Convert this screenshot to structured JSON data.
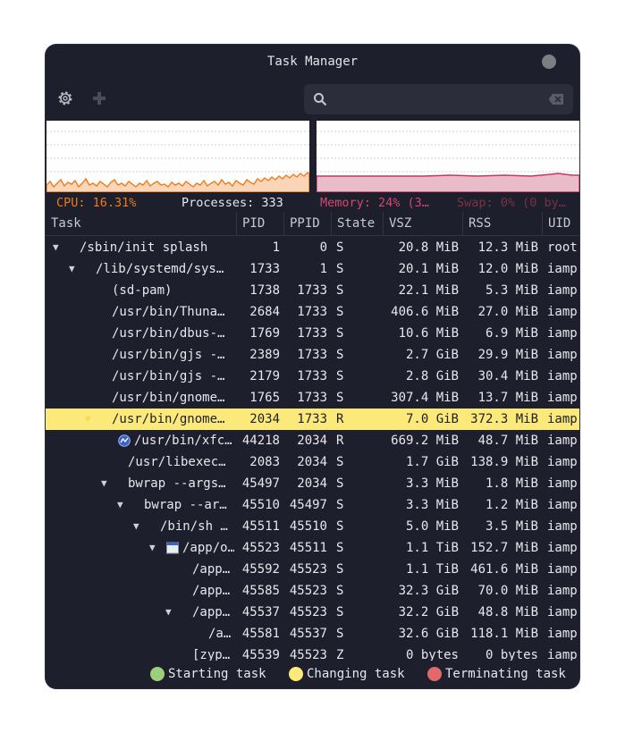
{
  "window": {
    "title": "Task Manager"
  },
  "toolbar": {
    "settings_icon": "gear-icon",
    "add_icon": "plus-icon",
    "search_placeholder": "",
    "search_icon": "search-icon",
    "clear_icon": "clear-icon"
  },
  "stats": {
    "cpu": "CPU: 16.31%",
    "processes": "Processes: 333",
    "memory": "Memory: 24% (3…",
    "swap": "Swap: 0% (0 by…"
  },
  "colors": {
    "cpu": "#f07a16",
    "memory": "#c23a64",
    "swap": "#7a3246",
    "highlight": "#fbe97a",
    "starting": "#9ccf7a",
    "changing": "#fbe97a",
    "terminating": "#e06a6a"
  },
  "columns": [
    "Task",
    "PID",
    "PPID",
    "State",
    "VSZ",
    "RSS",
    "UID"
  ],
  "rows": [
    {
      "task": "/sbin/init splash",
      "pid": "1",
      "ppid": "0",
      "state": "S",
      "vsz": "20.8 MiB",
      "rss": "12.3 MiB",
      "uid": "root"
    },
    {
      "task": "/lib/systemd/sys…",
      "pid": "1733",
      "ppid": "1",
      "state": "S",
      "vsz": "20.1 MiB",
      "rss": "12.0 MiB",
      "uid": "iampr"
    },
    {
      "task": "(sd-pam)",
      "pid": "1738",
      "ppid": "1733",
      "state": "S",
      "vsz": "22.1 MiB",
      "rss": "5.3 MiB",
      "uid": "iampr"
    },
    {
      "task": "/usr/bin/Thuna…",
      "pid": "2684",
      "ppid": "1733",
      "state": "S",
      "vsz": "406.6 MiB",
      "rss": "27.0 MiB",
      "uid": "iampr"
    },
    {
      "task": "/usr/bin/dbus-…",
      "pid": "1769",
      "ppid": "1733",
      "state": "S",
      "vsz": "10.6 MiB",
      "rss": "6.9 MiB",
      "uid": "iampr"
    },
    {
      "task": "/usr/bin/gjs -…",
      "pid": "2389",
      "ppid": "1733",
      "state": "S",
      "vsz": "2.7 GiB",
      "rss": "29.9 MiB",
      "uid": "iampr"
    },
    {
      "task": "/usr/bin/gjs -…",
      "pid": "2179",
      "ppid": "1733",
      "state": "S",
      "vsz": "2.8 GiB",
      "rss": "30.4 MiB",
      "uid": "iampr"
    },
    {
      "task": "/usr/bin/gnome…",
      "pid": "1765",
      "ppid": "1733",
      "state": "S",
      "vsz": "307.4 MiB",
      "rss": "13.7 MiB",
      "uid": "iampr"
    },
    {
      "task": "/usr/bin/gnome…",
      "pid": "2034",
      "ppid": "1733",
      "state": "R",
      "vsz": "7.0 GiB",
      "rss": "372.3 MiB",
      "uid": "iampr",
      "highlight": true
    },
    {
      "task": "/usr/bin/xfc…",
      "pid": "44218",
      "ppid": "2034",
      "state": "R",
      "vsz": "669.2 MiB",
      "rss": "48.7 MiB",
      "uid": "iampr"
    },
    {
      "task": "/usr/libexec…",
      "pid": "2083",
      "ppid": "2034",
      "state": "S",
      "vsz": "1.7 GiB",
      "rss": "138.9 MiB",
      "uid": "iampr"
    },
    {
      "task": "bwrap --args…",
      "pid": "45497",
      "ppid": "2034",
      "state": "S",
      "vsz": "3.3 MiB",
      "rss": "1.8 MiB",
      "uid": "iampr"
    },
    {
      "task": "bwrap --ar…",
      "pid": "45510",
      "ppid": "45497",
      "state": "S",
      "vsz": "3.3 MiB",
      "rss": "1.2 MiB",
      "uid": "iampr"
    },
    {
      "task": "/bin/sh …",
      "pid": "45511",
      "ppid": "45510",
      "state": "S",
      "vsz": "5.0 MiB",
      "rss": "3.5 MiB",
      "uid": "iampr"
    },
    {
      "task": "/app/o…",
      "pid": "45523",
      "ppid": "45511",
      "state": "S",
      "vsz": "1.1 TiB",
      "rss": "152.7 MiB",
      "uid": "iampr"
    },
    {
      "task": "/app…",
      "pid": "45592",
      "ppid": "45523",
      "state": "S",
      "vsz": "1.1 TiB",
      "rss": "461.6 MiB",
      "uid": "iampr"
    },
    {
      "task": "/app…",
      "pid": "45585",
      "ppid": "45523",
      "state": "S",
      "vsz": "32.3 GiB",
      "rss": "70.0 MiB",
      "uid": "iampr"
    },
    {
      "task": "/app…",
      "pid": "45537",
      "ppid": "45523",
      "state": "S",
      "vsz": "32.2 GiB",
      "rss": "48.8 MiB",
      "uid": "iampr"
    },
    {
      "task": "/a…",
      "pid": "45581",
      "ppid": "45537",
      "state": "S",
      "vsz": "32.6 GiB",
      "rss": "118.1 MiB",
      "uid": "iampr"
    },
    {
      "task": "[zyp…",
      "pid": "45539",
      "ppid": "45523",
      "state": "Z",
      "vsz": "0 bytes",
      "rss": "0 bytes",
      "uid": "iampr"
    }
  ],
  "legend": {
    "starting": "Starting task",
    "changing": "Changing task",
    "terminating": "Terminating task"
  }
}
